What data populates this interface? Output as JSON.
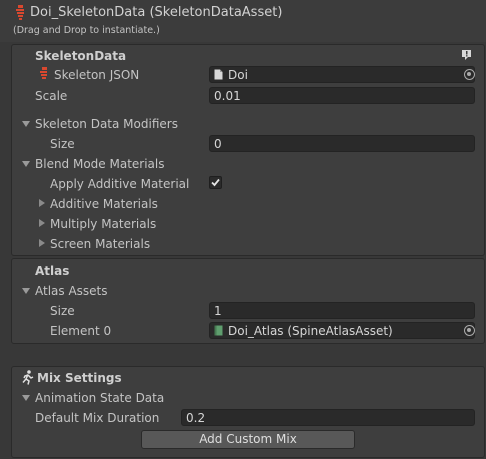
{
  "header": {
    "title": "Doi_SkeletonData (SkeletonDataAsset)",
    "subtitle": "(Drag and Drop to instantiate.)"
  },
  "skeleton_data": {
    "section_title": "SkeletonData",
    "json_label": "Skeleton JSON",
    "json_value": "Doi",
    "scale_label": "Scale",
    "scale_value": "0.01"
  },
  "modifiers": {
    "label": "Skeleton Data Modifiers",
    "size_label": "Size",
    "size_value": "0"
  },
  "blend": {
    "label": "Blend Mode Materials",
    "apply_additive_label": "Apply Additive Material",
    "apply_additive_checked": true,
    "additive_label": "Additive Materials",
    "multiply_label": "Multiply Materials",
    "screen_label": "Screen Materials"
  },
  "atlas": {
    "section_title": "Atlas",
    "assets_label": "Atlas Assets",
    "size_label": "Size",
    "size_value": "1",
    "element0_label": "Element 0",
    "element0_value": "Doi_Atlas (SpineAtlasAsset)"
  },
  "mix": {
    "section_title": "Mix Settings",
    "animation_state_label": "Animation State Data",
    "default_mix_label": "Default Mix Duration",
    "default_mix_value": "0.2",
    "add_custom_mix_label": "Add Custom Mix"
  },
  "colors": {
    "spine_icon": "#d9482f",
    "atlas_icon": "#5f9e6e"
  }
}
